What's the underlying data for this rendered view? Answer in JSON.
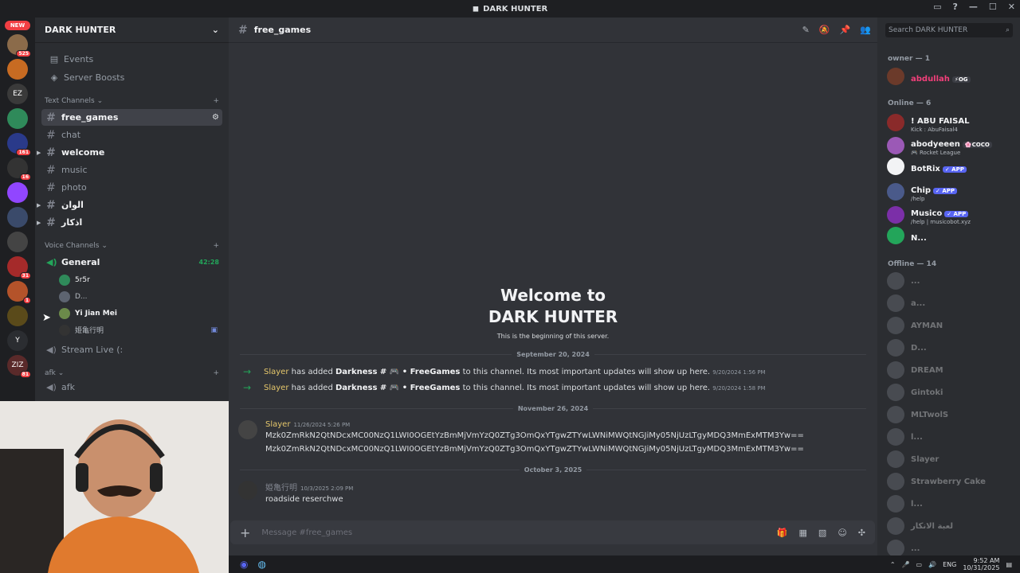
{
  "window": {
    "title": "DARK HUNTER"
  },
  "guilds": {
    "new_label": "NEW",
    "items": [
      {
        "badge": "525",
        "color": "#8b6b4a"
      },
      {
        "badge": "",
        "color": "#c76b22"
      },
      {
        "badge": "",
        "color": "#3a3a3a",
        "label": "EZ"
      },
      {
        "badge": "",
        "color": "#2f8a5a"
      },
      {
        "badge": "161",
        "color": "#2a3a8a"
      },
      {
        "badge": "16",
        "color": "#333"
      },
      {
        "badge": "",
        "color": "#9146ff"
      },
      {
        "badge": "",
        "color": "#3a4a6a"
      },
      {
        "badge": "",
        "color": "#444"
      },
      {
        "badge": "31",
        "color": "#a52a2a"
      },
      {
        "badge": "1",
        "color": "#b4532a"
      },
      {
        "badge": "",
        "color": "#5a4a1a"
      },
      {
        "badge": "",
        "color": "#2b2d31",
        "label": "Y"
      },
      {
        "badge": "81",
        "color": "#5a2a2a",
        "label": "ZIZ"
      }
    ]
  },
  "sidebar": {
    "server_name": "DARK HUNTER",
    "events": "Events",
    "boosts": "Server Boosts",
    "text_category": "Text Channels",
    "text_channels": [
      "free_games",
      "chat",
      "welcome",
      "music",
      "photo",
      "الوان",
      "اذكار"
    ],
    "voice_category": "Voice Channels",
    "voice_channel": "General",
    "voice_timer": "42:28",
    "voice_users": [
      "5r5r",
      "D...",
      "Yi Jian Mei",
      "姫亀行明"
    ],
    "stream_channel": "Stream Live (:",
    "afk_category": "afk",
    "afk_channel": "afk"
  },
  "channel": {
    "name": "free_games",
    "welcome_line1": "Welcome to",
    "welcome_line2": "DARK HUNTER",
    "welcome_sub": "This is the beginning of this server.",
    "date1": "September 20, 2024",
    "sys1": {
      "user": "Slayer",
      "text1": "has added",
      "target": "Darkness # 🎮 • FreeGames",
      "text2": "to this channel. Its most important updates will show up here.",
      "ts": "9/20/2024 1:56 PM"
    },
    "sys2": {
      "user": "Slayer",
      "text1": "has added",
      "target": "Darkness # 🎮 • FreeGames",
      "text2": "to this channel. Its most important updates will show up here.",
      "ts": "9/20/2024 1:58 PM"
    },
    "date2": "November 26, 2024",
    "msg1": {
      "user": "Slayer",
      "ts": "11/26/2024 5:26 PM",
      "line1": "Mzk0ZmRkN2QtNDcxMC00NzQ1LWI0OGEtYzBmMjVmYzQ0ZTg3OmQxYTgwZTYwLWNiMWQtNGJiMy05NjUzLTgyMDQ3MmExMTM3Yw==",
      "line2": "Mzk0ZmRkN2QtNDcxMC00NzQ1LWI0OGEtYzBmMjVmYzQ0ZTg3OmQxYTgwZTYwLWNiMWQtNGJiMy05NjUzLTgyMDQ3MmExMTM3Yw=="
    },
    "date3": "October 3, 2025",
    "msg2": {
      "user": "姫亀行明",
      "ts": "10/3/2025 2:09 PM",
      "line1": "roadside reserchwe"
    },
    "composer_placeholder": "Message #free_games"
  },
  "members": {
    "search_placeholder": "Search DARK HUNTER",
    "owner_header": "owner — 1",
    "owner": {
      "name": "abdullah",
      "tag": "⚡OG"
    },
    "online_header": "Online — 6",
    "online": [
      {
        "name": "! ABU FAISAL",
        "sub": "Kick : AbuFaisal4",
        "tag": ""
      },
      {
        "name": "abodyeeen",
        "sub": "🎮 Rocket League",
        "tag": "🌸COCO"
      },
      {
        "name": "BotRix",
        "sub": "",
        "tag": "✓ APP"
      },
      {
        "name": "Chip",
        "sub": "/help",
        "tag": "✓ APP"
      },
      {
        "name": "Musico",
        "sub": "/help | musicobot.xyz",
        "tag": "✓ APP"
      },
      {
        "name": "N...",
        "sub": "",
        "tag": ""
      }
    ],
    "offline_header": "Offline — 14",
    "offline": [
      "...",
      "a...",
      "AYMAN",
      "D...",
      "DREAM",
      "Gintoki",
      "MLTwolS",
      "l...",
      "Slayer",
      "Strawberry Cake",
      "l...",
      "لعبة الانكار",
      "..."
    ]
  },
  "taskbar": {
    "lang": "ENG",
    "time": "9:52 AM",
    "date": "10/31/2025"
  }
}
